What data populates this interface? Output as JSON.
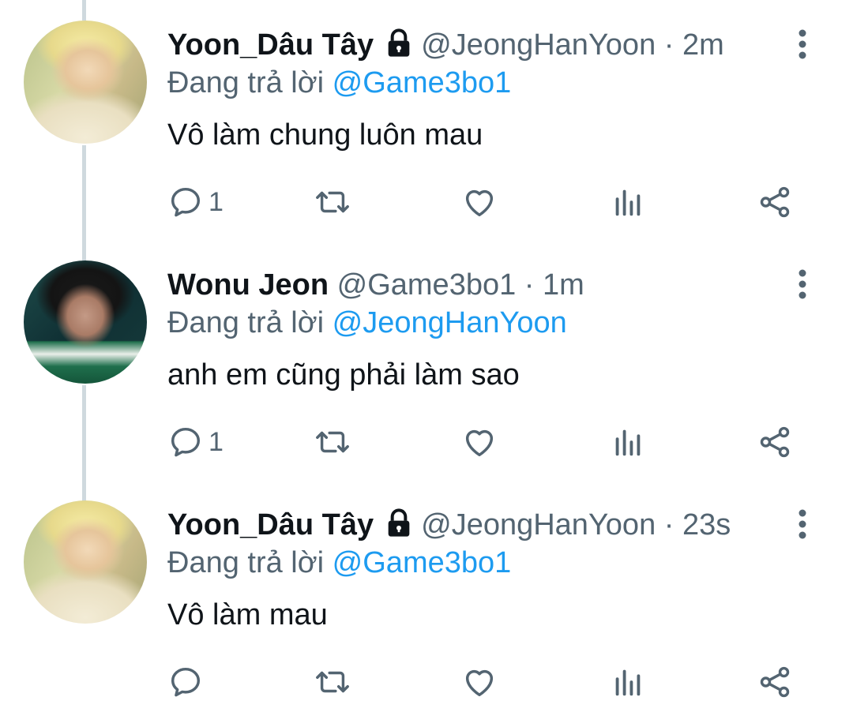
{
  "colors": {
    "text": "#0f1419",
    "secondary": "#536471",
    "mention": "#1d9bf0",
    "thread_line": "#cfd9de"
  },
  "tweets": [
    {
      "display_name": "Yoon_Dâu Tây",
      "protected": true,
      "handle": "@JeongHanYoon",
      "separator": "·",
      "time": "2m",
      "reply_prefix": "Đang trả lời",
      "reply_to": "@Game3bo1",
      "text": "Vô làm chung luôn mau",
      "reply_count": "1"
    },
    {
      "display_name": "Wonu Jeon",
      "protected": false,
      "handle": "@Game3bo1",
      "separator": "·",
      "time": "1m",
      "reply_prefix": "Đang trả lời",
      "reply_to": "@JeongHanYoon",
      "text": "anh em cũng phải làm sao",
      "reply_count": "1"
    },
    {
      "display_name": "Yoon_Dâu Tây",
      "protected": true,
      "handle": "@JeongHanYoon",
      "separator": "·",
      "time": "23s",
      "reply_prefix": "Đang trả lời",
      "reply_to": "@Game3bo1",
      "text": "Vô làm mau",
      "reply_count": ""
    }
  ],
  "icons": {
    "protected": "lock-icon",
    "more": "more-vertical-icon",
    "reply": "reply-icon",
    "retweet": "retweet-icon",
    "like": "heart-icon",
    "views": "views-icon",
    "share": "share-icon"
  }
}
